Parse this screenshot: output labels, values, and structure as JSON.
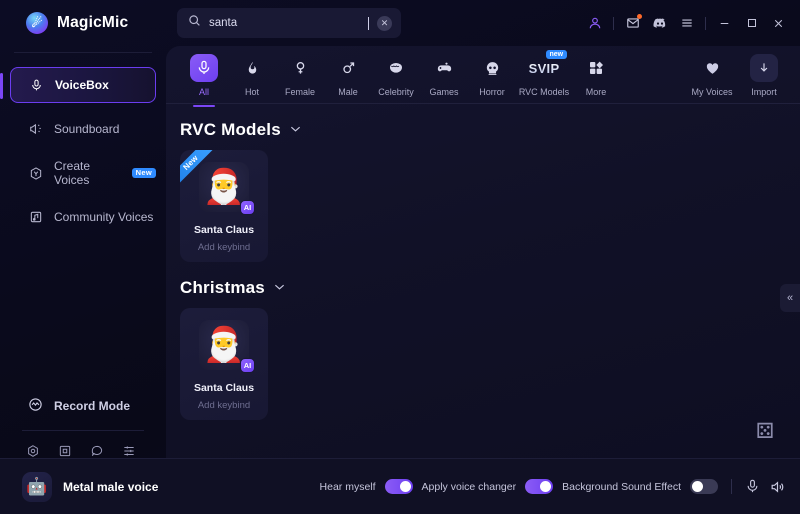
{
  "app": {
    "brand": "MagicMic",
    "logo_icon": "magicmic-logo-icon"
  },
  "search": {
    "value": "santa",
    "placeholder": "Search",
    "icon": "search-icon",
    "clear_icon": "clear-icon"
  },
  "titlebar": {
    "account_icon": "account-icon",
    "mail_icon": "mail-icon",
    "discord_icon": "discord-icon",
    "menu_icon": "hamburger-menu-icon",
    "minimize_icon": "minimize-icon",
    "maximize_icon": "maximize-icon",
    "close_icon": "close-icon"
  },
  "sidebar": {
    "items": [
      {
        "label": "VoiceBox",
        "icon": "microphone-icon",
        "active": true,
        "badge": ""
      },
      {
        "label": "Soundboard",
        "icon": "soundboard-icon",
        "active": false,
        "badge": ""
      },
      {
        "label": "Create Voices",
        "icon": "create-voices-icon",
        "active": false,
        "badge": "New"
      },
      {
        "label": "Community Voices",
        "icon": "community-voices-icon",
        "active": false,
        "badge": ""
      }
    ],
    "record_mode": {
      "label": "Record Mode",
      "icon": "record-mode-icon"
    },
    "bottom_icons": [
      "settings-icon",
      "tutorial-icon",
      "feedback-icon",
      "mixer-icon"
    ]
  },
  "tabs": [
    {
      "label": "All",
      "icon": "microphone-icon",
      "active": true,
      "badge": ""
    },
    {
      "label": "Hot",
      "icon": "flame-icon",
      "active": false,
      "badge": ""
    },
    {
      "label": "Female",
      "icon": "female-icon",
      "active": false,
      "badge": ""
    },
    {
      "label": "Male",
      "icon": "male-icon",
      "active": false,
      "badge": ""
    },
    {
      "label": "Celebrity",
      "icon": "celebrity-icon",
      "active": false,
      "badge": ""
    },
    {
      "label": "Games",
      "icon": "gamepad-icon",
      "active": false,
      "badge": ""
    },
    {
      "label": "Horror",
      "icon": "skull-icon",
      "active": false,
      "badge": ""
    },
    {
      "label": "RVC Models",
      "icon": "svip-icon",
      "active": false,
      "badge": "new"
    },
    {
      "label": "More",
      "icon": "grid-icon",
      "active": false,
      "badge": ""
    }
  ],
  "tabs_right": [
    {
      "label": "My Voices",
      "icon": "heart-icon"
    },
    {
      "label": "Import",
      "icon": "import-icon"
    }
  ],
  "sections": [
    {
      "title": "RVC Models",
      "chevron": "chevron-down-icon",
      "cards": [
        {
          "title": "Santa Claus",
          "subtitle": "Add keybind",
          "ribbon": "New",
          "ai_badge": "AI",
          "thumb": "santa-claus-thumbnail"
        }
      ]
    },
    {
      "title": "Christmas",
      "chevron": "chevron-down-icon",
      "cards": [
        {
          "title": "Santa Claus",
          "subtitle": "Add keybind",
          "ribbon": "",
          "ai_badge": "AI",
          "thumb": "santa-claus-thumbnail"
        }
      ]
    }
  ],
  "panel": {
    "collapse_icon": "collapse-left-icon",
    "random_icon": "dice-icon"
  },
  "bottombar": {
    "current_voice": "Metal male voice",
    "current_voice_icon": "robot-avatar-icon",
    "toggles": [
      {
        "label": "Hear myself",
        "on": true
      },
      {
        "label": "Apply voice changer",
        "on": true
      },
      {
        "label": "Background Sound Effect",
        "on": false
      }
    ],
    "mic_icon": "microphone-icon",
    "speaker_icon": "speaker-icon"
  },
  "colors": {
    "accent": "#7b46f5",
    "badge_blue": "#2f8bff",
    "notification": "#ff6a2a"
  }
}
